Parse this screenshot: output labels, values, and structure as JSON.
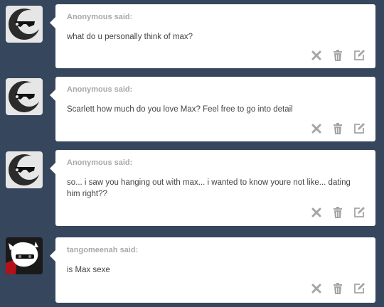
{
  "colors": {
    "background": "#36465d",
    "card": "#ffffff",
    "asker_name": "#a8a8a8",
    "question_text": "#444444",
    "action_icon": "#a5a5a5"
  },
  "icons": {
    "delete": "close-icon",
    "trash": "trash-icon",
    "edit": "edit-icon"
  },
  "asks": [
    {
      "asker": "Anonymous said:",
      "question": "what do u personally think of max?",
      "avatar": "anonymous-avatar"
    },
    {
      "asker": "Anonymous said:",
      "question": "Scarlett how much do you love Max? Feel free to go into detail",
      "avatar": "anonymous-avatar"
    },
    {
      "asker": "Anonymous said:",
      "question": "so... i saw you hanging out with max... i wanted to know youre not like... dating him right??",
      "avatar": "anonymous-avatar"
    },
    {
      "asker": "tangomeenah said:",
      "question": "is Max sexe",
      "avatar": "user-avatar"
    }
  ]
}
